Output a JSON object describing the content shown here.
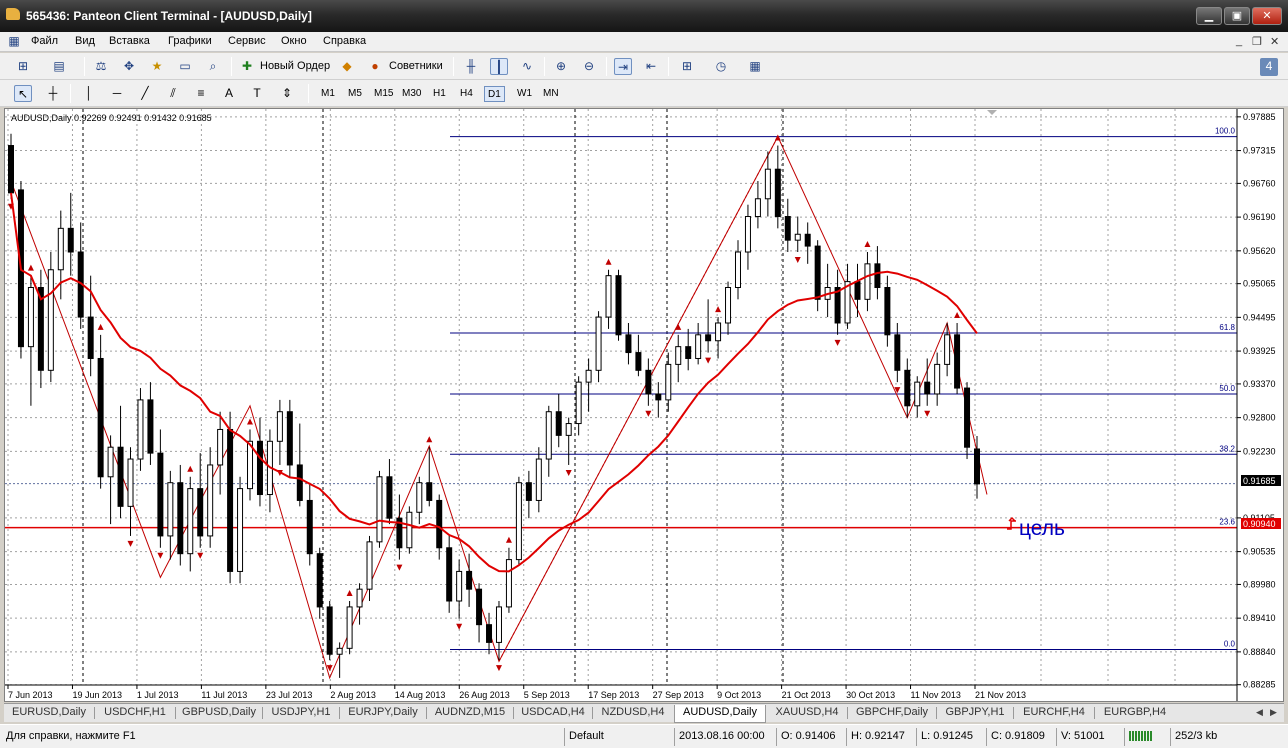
{
  "window": {
    "title": "565436: Panteon Client Terminal - [AUDUSD,Daily]",
    "min_label": "▁",
    "max_label": "▣",
    "close_label": "✕"
  },
  "menu": [
    {
      "label": "Файл"
    },
    {
      "label": "Вид"
    },
    {
      "label": "Вставка"
    },
    {
      "label": "Графики"
    },
    {
      "label": "Сервис"
    },
    {
      "label": "Окно"
    },
    {
      "label": "Справка"
    }
  ],
  "toolbar": {
    "new_order": "Новый Ордер",
    "advisors": "Советники"
  },
  "timeframes": [
    "M1",
    "M5",
    "M15",
    "M30",
    "H1",
    "H4",
    "D1",
    "W1",
    "MN"
  ],
  "active_timeframe": "D1",
  "chart": {
    "header": "AUDUSD,Daily  0.92269 0.92491 0.91432 0.91685",
    "annotation": "цель",
    "current_price": "0.91685",
    "target_price": "0.90940",
    "colors": {
      "bull": "#ffffff",
      "bear": "#000000",
      "ma": "#e00000",
      "fibo": "#000080",
      "grid": "#a0a0a0",
      "target": "#e00000",
      "annotation": "#0000c0",
      "price_label": "#e00000"
    }
  },
  "chart_data": {
    "type": "candlestick",
    "symbol": "AUDUSD",
    "timeframe": "Daily",
    "ylim": [
      0.8828,
      0.9795
    ],
    "y_ticks": [
      "0.97885",
      "0.97315",
      "0.96760",
      "0.96190",
      "0.95620",
      "0.95065",
      "0.94495",
      "0.93925",
      "0.93370",
      "0.92800",
      "0.92230",
      "0.91105",
      "0.90535",
      "0.89980",
      "0.89410",
      "0.88840",
      "0.88285"
    ],
    "x_labels": [
      "7 Jun 2013",
      "19 Jun 2013",
      "1 Jul 2013",
      "11 Jul 2013",
      "23 Jul 2013",
      "2 Aug 2013",
      "14 Aug 2013",
      "26 Aug 2013",
      "5 Sep 2013",
      "17 Sep 2013",
      "27 Sep 2013",
      "9 Oct 2013",
      "21 Oct 2013",
      "30 Oct 2013",
      "11 Nov 2013",
      "21 Nov 2013"
    ],
    "candles": [
      [
        0.974,
        0.976,
        0.965,
        0.966
      ],
      [
        0.9665,
        0.968,
        0.938,
        0.94
      ],
      [
        0.94,
        0.952,
        0.93,
        0.95
      ],
      [
        0.95,
        0.953,
        0.933,
        0.936
      ],
      [
        0.936,
        0.956,
        0.934,
        0.953
      ],
      [
        0.953,
        0.963,
        0.948,
        0.96
      ],
      [
        0.96,
        0.966,
        0.952,
        0.956
      ],
      [
        0.956,
        0.961,
        0.943,
        0.945
      ],
      [
        0.945,
        0.952,
        0.935,
        0.938
      ],
      [
        0.938,
        0.942,
        0.916,
        0.918
      ],
      [
        0.918,
        0.925,
        0.91,
        0.923
      ],
      [
        0.923,
        0.93,
        0.911,
        0.913
      ],
      [
        0.913,
        0.923,
        0.908,
        0.921
      ],
      [
        0.921,
        0.933,
        0.919,
        0.931
      ],
      [
        0.931,
        0.934,
        0.92,
        0.922
      ],
      [
        0.922,
        0.926,
        0.906,
        0.908
      ],
      [
        0.908,
        0.919,
        0.904,
        0.917
      ],
      [
        0.917,
        0.92,
        0.903,
        0.905
      ],
      [
        0.905,
        0.918,
        0.902,
        0.916
      ],
      [
        0.916,
        0.922,
        0.906,
        0.908
      ],
      [
        0.908,
        0.923,
        0.906,
        0.92
      ],
      [
        0.92,
        0.929,
        0.915,
        0.926
      ],
      [
        0.926,
        0.929,
        0.9,
        0.902
      ],
      [
        0.902,
        0.918,
        0.9,
        0.916
      ],
      [
        0.916,
        0.926,
        0.914,
        0.924
      ],
      [
        0.924,
        0.928,
        0.913,
        0.915
      ],
      [
        0.915,
        0.926,
        0.912,
        0.924
      ],
      [
        0.924,
        0.931,
        0.92,
        0.929
      ],
      [
        0.929,
        0.931,
        0.918,
        0.92
      ],
      [
        0.92,
        0.927,
        0.913,
        0.914
      ],
      [
        0.914,
        0.917,
        0.903,
        0.905
      ],
      [
        0.905,
        0.906,
        0.894,
        0.896
      ],
      [
        0.896,
        0.897,
        0.887,
        0.888
      ],
      [
        0.888,
        0.89,
        0.884,
        0.889
      ],
      [
        0.889,
        0.897,
        0.888,
        0.896
      ],
      [
        0.896,
        0.9,
        0.893,
        0.899
      ],
      [
        0.899,
        0.908,
        0.897,
        0.907
      ],
      [
        0.907,
        0.919,
        0.906,
        0.918
      ],
      [
        0.918,
        0.921,
        0.91,
        0.911
      ],
      [
        0.911,
        0.915,
        0.904,
        0.906
      ],
      [
        0.906,
        0.913,
        0.905,
        0.912
      ],
      [
        0.912,
        0.918,
        0.91,
        0.917
      ],
      [
        0.917,
        0.923,
        0.913,
        0.914
      ],
      [
        0.914,
        0.915,
        0.904,
        0.906
      ],
      [
        0.906,
        0.908,
        0.895,
        0.897
      ],
      [
        0.897,
        0.904,
        0.894,
        0.902
      ],
      [
        0.902,
        0.905,
        0.896,
        0.899
      ],
      [
        0.899,
        0.9,
        0.89,
        0.893
      ],
      [
        0.893,
        0.895,
        0.888,
        0.89
      ],
      [
        0.89,
        0.897,
        0.887,
        0.896
      ],
      [
        0.896,
        0.906,
        0.895,
        0.904
      ],
      [
        0.904,
        0.918,
        0.903,
        0.917
      ],
      [
        0.917,
        0.919,
        0.911,
        0.914
      ],
      [
        0.914,
        0.923,
        0.912,
        0.921
      ],
      [
        0.921,
        0.93,
        0.918,
        0.929
      ],
      [
        0.929,
        0.932,
        0.923,
        0.925
      ],
      [
        0.925,
        0.928,
        0.92,
        0.927
      ],
      [
        0.927,
        0.935,
        0.925,
        0.934
      ],
      [
        0.934,
        0.938,
        0.929,
        0.936
      ],
      [
        0.936,
        0.946,
        0.934,
        0.945
      ],
      [
        0.945,
        0.953,
        0.943,
        0.952
      ],
      [
        0.952,
        0.953,
        0.941,
        0.942
      ],
      [
        0.942,
        0.944,
        0.937,
        0.939
      ],
      [
        0.939,
        0.942,
        0.935,
        0.936
      ],
      [
        0.936,
        0.938,
        0.93,
        0.932
      ],
      [
        0.932,
        0.934,
        0.928,
        0.931
      ],
      [
        0.931,
        0.939,
        0.929,
        0.937
      ],
      [
        0.937,
        0.942,
        0.934,
        0.94
      ],
      [
        0.94,
        0.943,
        0.936,
        0.938
      ],
      [
        0.938,
        0.944,
        0.937,
        0.942
      ],
      [
        0.942,
        0.948,
        0.939,
        0.941
      ],
      [
        0.941,
        0.945,
        0.938,
        0.944
      ],
      [
        0.944,
        0.951,
        0.942,
        0.95
      ],
      [
        0.95,
        0.958,
        0.948,
        0.956
      ],
      [
        0.956,
        0.964,
        0.953,
        0.962
      ],
      [
        0.962,
        0.968,
        0.96,
        0.965
      ],
      [
        0.965,
        0.973,
        0.962,
        0.97
      ],
      [
        0.97,
        0.974,
        0.96,
        0.962
      ],
      [
        0.962,
        0.965,
        0.956,
        0.958
      ],
      [
        0.958,
        0.962,
        0.956,
        0.959
      ],
      [
        0.959,
        0.961,
        0.954,
        0.957
      ],
      [
        0.957,
        0.958,
        0.946,
        0.948
      ],
      [
        0.948,
        0.954,
        0.945,
        0.95
      ],
      [
        0.95,
        0.953,
        0.942,
        0.944
      ],
      [
        0.944,
        0.954,
        0.943,
        0.951
      ],
      [
        0.951,
        0.954,
        0.945,
        0.948
      ],
      [
        0.948,
        0.956,
        0.946,
        0.954
      ],
      [
        0.954,
        0.957,
        0.948,
        0.95
      ],
      [
        0.95,
        0.952,
        0.94,
        0.942
      ],
      [
        0.942,
        0.944,
        0.934,
        0.936
      ],
      [
        0.936,
        0.938,
        0.928,
        0.93
      ],
      [
        0.93,
        0.935,
        0.928,
        0.934
      ],
      [
        0.934,
        0.938,
        0.93,
        0.932
      ],
      [
        0.932,
        0.939,
        0.93,
        0.937
      ],
      [
        0.937,
        0.944,
        0.935,
        0.942
      ],
      [
        0.942,
        0.944,
        0.932,
        0.933
      ],
      [
        0.933,
        0.934,
        0.921,
        0.923
      ],
      [
        0.9227,
        0.9249,
        0.9143,
        0.9168
      ]
    ],
    "ma_period": 20,
    "fibo_levels": [
      {
        "label": "100.0",
        "price": 0.9755
      },
      {
        "label": "61.8",
        "price": 0.9423
      },
      {
        "label": "50.0",
        "price": 0.932
      },
      {
        "label": "38.2",
        "price": 0.9218
      },
      {
        "label": "23.6",
        "price": 0.9094
      },
      {
        "label": "0.0",
        "price": 0.8888
      }
    ],
    "target_level": 0.9094,
    "current_level": 0.91685
  },
  "tabs": [
    {
      "label": "EURUSD,Daily"
    },
    {
      "label": "USDCHF,H1"
    },
    {
      "label": "GBPUSD,Daily"
    },
    {
      "label": "USDJPY,H1"
    },
    {
      "label": "EURJPY,Daily"
    },
    {
      "label": "AUDNZD,M15"
    },
    {
      "label": "USDCAD,H4"
    },
    {
      "label": "NZDUSD,H4"
    },
    {
      "label": "AUDUSD,Daily"
    },
    {
      "label": "XAUUSD,H4"
    },
    {
      "label": "GBPCHF,Daily"
    },
    {
      "label": "GBPJPY,H1"
    },
    {
      "label": "EURCHF,H4"
    },
    {
      "label": "EURGBP,H4"
    }
  ],
  "active_tab": "AUDUSD,Daily",
  "status": {
    "help": "Для справки, нажмите F1",
    "profile": "Default",
    "datetime": "2013.08.16 00:00",
    "open": "O: 0.91406",
    "high": "H: 0.92147",
    "low": "L: 0.91245",
    "close": "C: 0.91809",
    "volume": "V: 51001",
    "traffic": "252/3 kb"
  }
}
